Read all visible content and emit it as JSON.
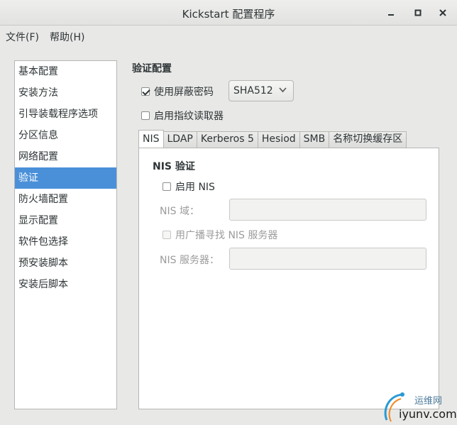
{
  "window": {
    "title": "Kickstart 配置程序",
    "minimize_icon": "minimize-icon",
    "maximize_icon": "maximize-icon",
    "close_icon": "close-icon"
  },
  "menubar": [
    {
      "label": "文件(F)"
    },
    {
      "label": "帮助(H)"
    }
  ],
  "sidebar": {
    "items": [
      {
        "label": "基本配置"
      },
      {
        "label": "安装方法"
      },
      {
        "label": "引导装载程序选项"
      },
      {
        "label": "分区信息"
      },
      {
        "label": "网络配置"
      },
      {
        "label": "验证",
        "selected": true
      },
      {
        "label": "防火墙配置"
      },
      {
        "label": "显示配置"
      },
      {
        "label": "软件包选择"
      },
      {
        "label": "预安装脚本"
      },
      {
        "label": "安装后脚本"
      }
    ],
    "selected_color": "#4a90d9"
  },
  "auth": {
    "section_title": "验证配置",
    "shadow_password": {
      "label": "使用屏蔽密码",
      "checked": true
    },
    "hash_algorithm": {
      "value": "SHA512"
    },
    "fingerprint": {
      "label": "启用指纹读取器",
      "checked": false
    }
  },
  "tabs": [
    {
      "label": "NIS",
      "active": true
    },
    {
      "label": "LDAP"
    },
    {
      "label": "Kerberos 5"
    },
    {
      "label": "Hesiod"
    },
    {
      "label": "SMB"
    },
    {
      "label": "名称切换缓存区"
    }
  ],
  "nis": {
    "title": "NIS 验证",
    "enable": {
      "label": "启用  NIS",
      "checked": false
    },
    "domain_label": "NIS 域：",
    "domain_value": "",
    "broadcast": {
      "label": "用广播寻找  NIS 服务器",
      "checked": false,
      "disabled": true
    },
    "server_label": "NIS 服务器：",
    "server_value": ""
  },
  "watermark": {
    "line1": "运维网",
    "line2": "iyunv.com"
  }
}
